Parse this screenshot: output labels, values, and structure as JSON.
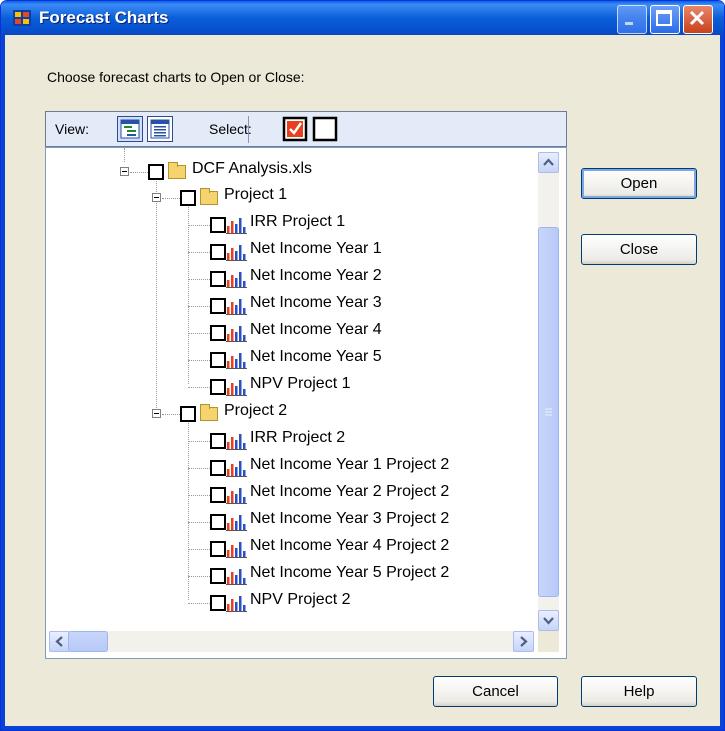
{
  "window": {
    "title": "Forecast Charts"
  },
  "prompt": "Choose forecast charts to Open or Close:",
  "toolbar": {
    "view_label": "View:",
    "select_label": "Select:"
  },
  "tree": {
    "workbook": "DCF Analysis.xls",
    "groups": [
      {
        "label": "Project 1",
        "charts": [
          "IRR Project 1",
          "Net Income Year 1",
          "Net Income Year 2",
          "Net Income Year 3",
          "Net Income Year 4",
          "Net Income Year 5",
          "NPV Project 1"
        ]
      },
      {
        "label": "Project 2",
        "charts": [
          "IRR Project 2",
          "Net Income Year 1 Project 2",
          "Net Income Year 2 Project 2",
          "Net Income Year 3 Project 2",
          "Net Income Year 4 Project 2",
          "Net Income Year 5 Project 2",
          "NPV Project 2"
        ]
      }
    ]
  },
  "buttons": {
    "open": "Open",
    "close": "Close",
    "cancel": "Cancel",
    "help": "Help"
  },
  "icons": {
    "checked_color": "#e8401e",
    "folder_color": "#f5d36f"
  }
}
